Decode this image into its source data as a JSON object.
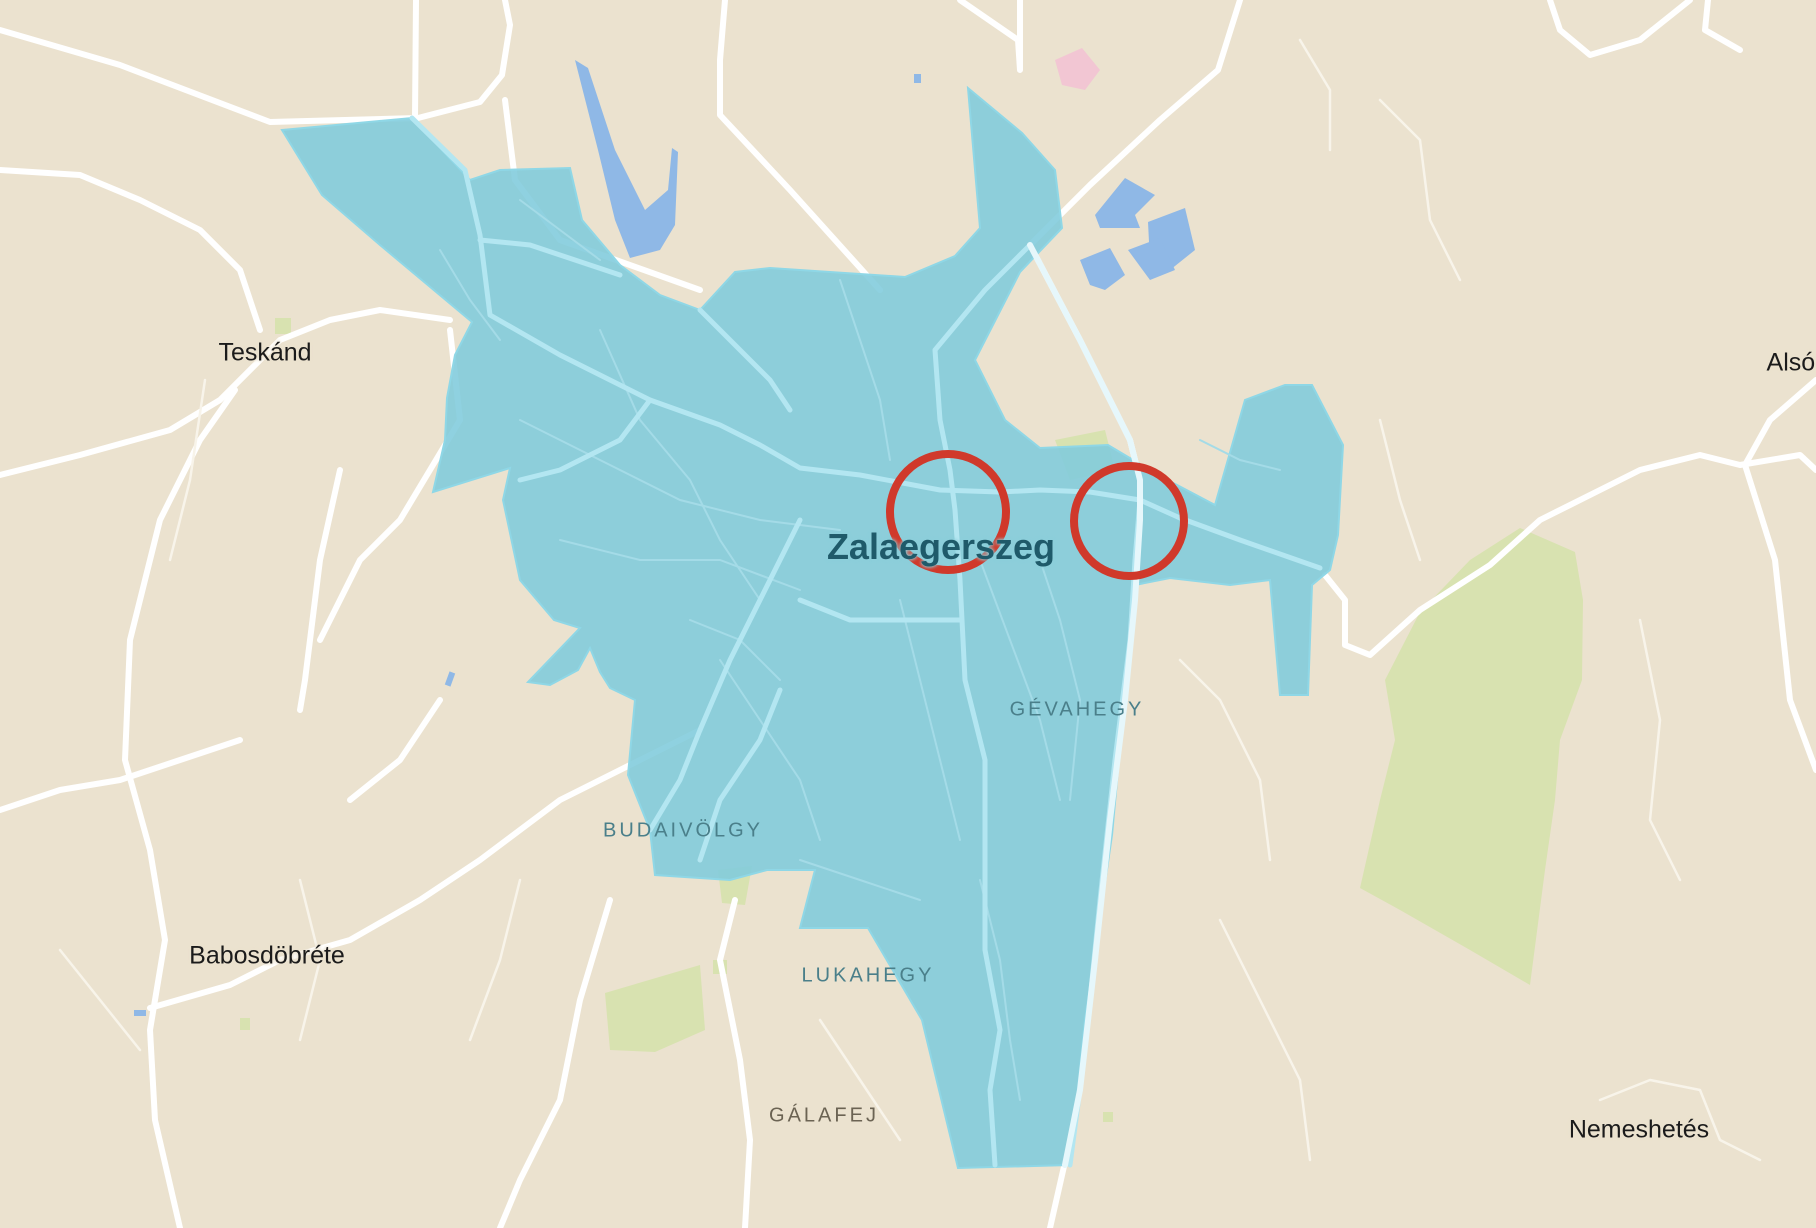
{
  "map": {
    "colors": {
      "land": "#ebe2cf",
      "road": "#ffffff",
      "water": "#8fb8e6",
      "park": "#d8e2b0",
      "boundary_fill": "#7fcbdc",
      "highlight_circle": "#d0392b"
    },
    "city_label": "Zalaegerszeg",
    "places": [
      {
        "id": "teskand",
        "name": "Teskánd"
      },
      {
        "id": "alsor",
        "name": "Alsór"
      },
      {
        "id": "babosdobrete",
        "name": "Babosdöbréte"
      },
      {
        "id": "nemeshetes",
        "name": "Nemeshetés"
      }
    ],
    "districts": [
      {
        "id": "gevahegy",
        "name": "GÉVAHEGY"
      },
      {
        "id": "budaivolgy",
        "name": "BUDAIVÖLGY"
      },
      {
        "id": "lukahegy",
        "name": "LUKAHEGY"
      },
      {
        "id": "galafej",
        "name": "GÁLAFEJ"
      }
    ],
    "markers": [
      {
        "id": "marker-1",
        "icon": "highlight-circle-icon"
      },
      {
        "id": "marker-2",
        "icon": "highlight-circle-icon"
      }
    ]
  }
}
